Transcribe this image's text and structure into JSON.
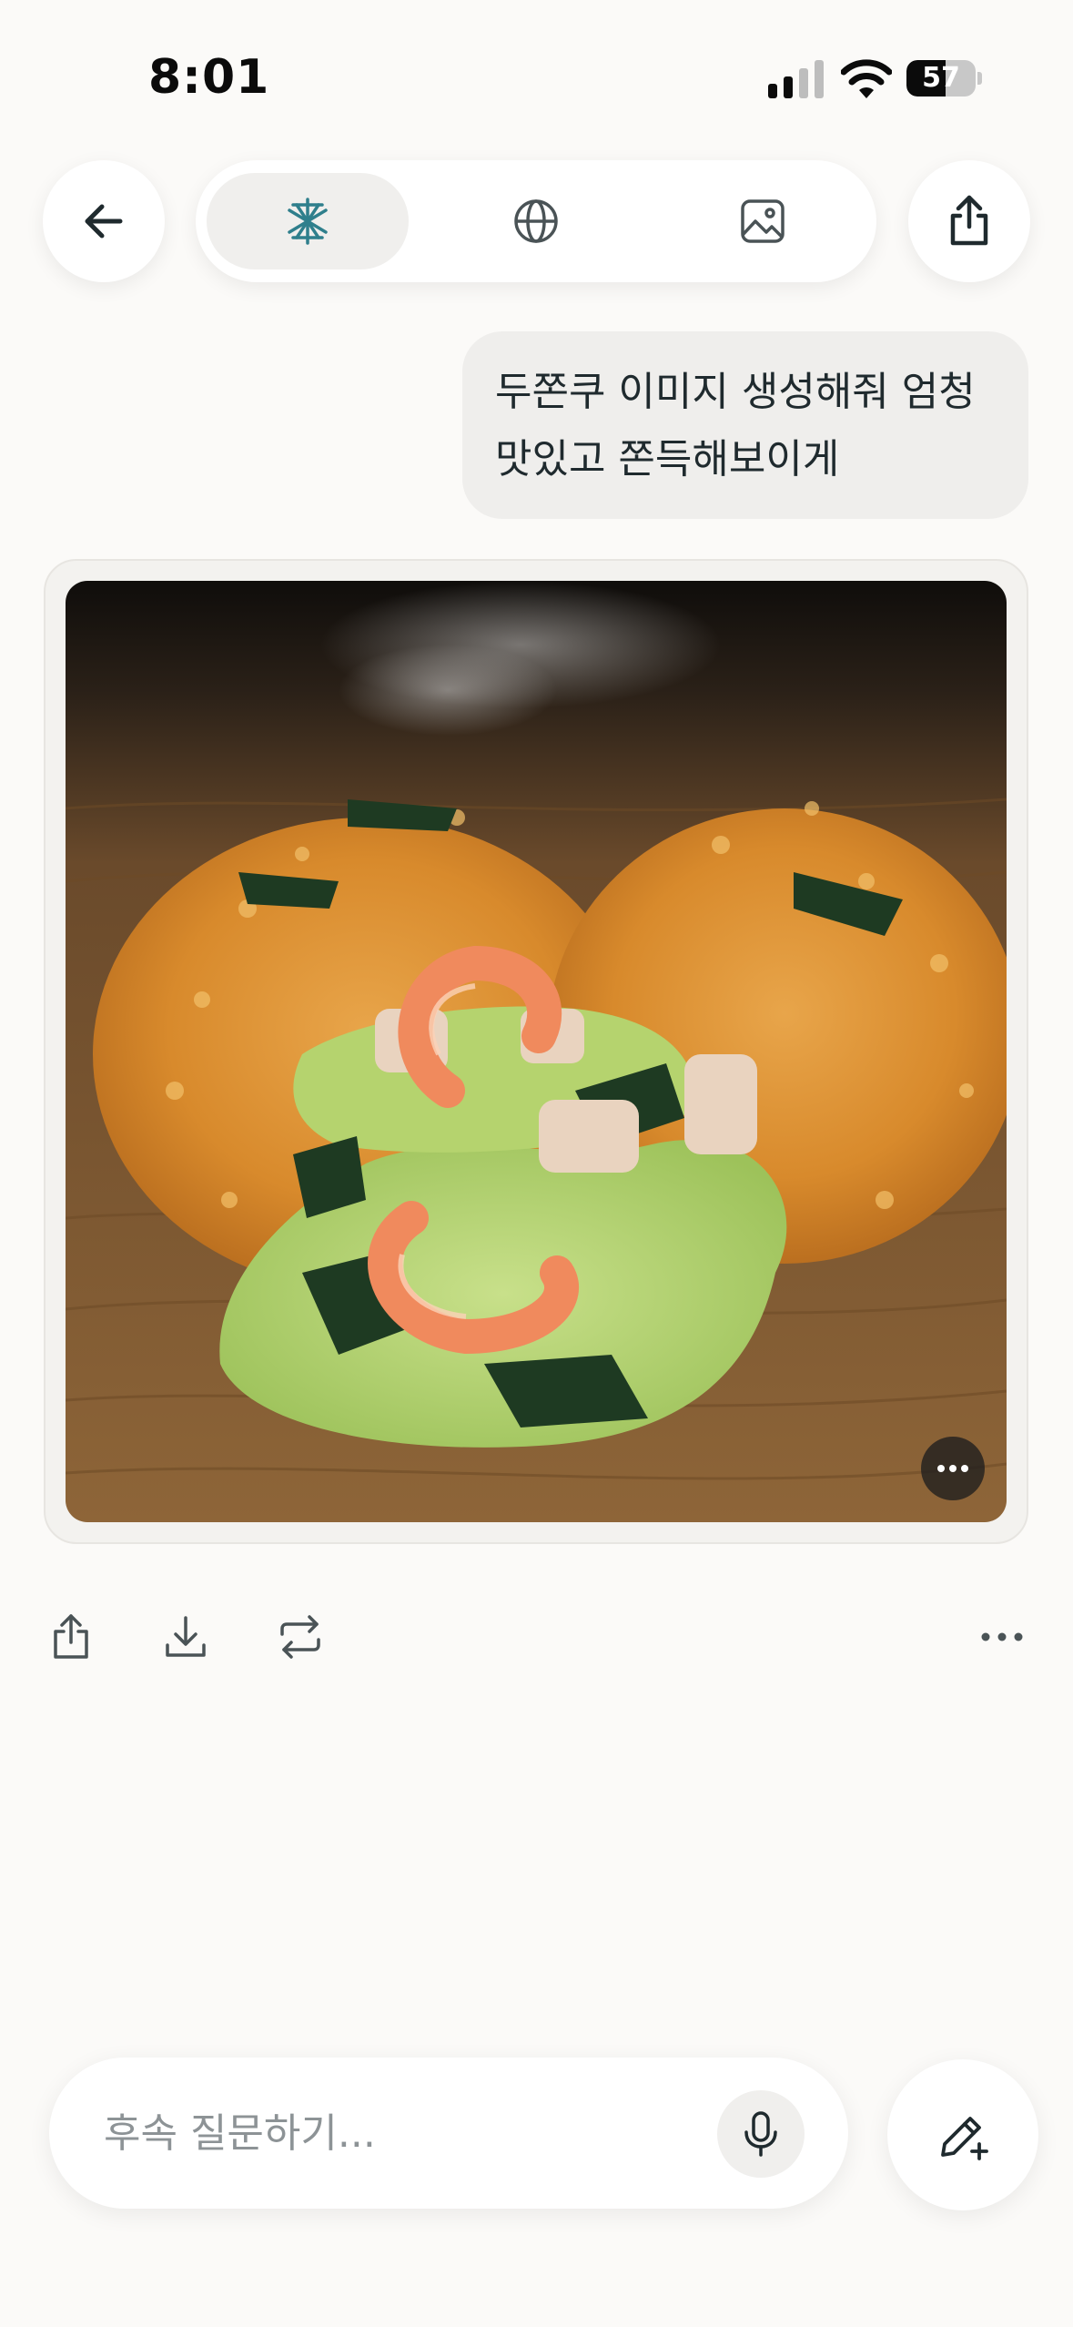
{
  "status_bar": {
    "time": "8:01",
    "battery": "57",
    "battery_level": 0.57
  },
  "top_bar": {
    "back_icon": "arrow-left-icon",
    "tabs": [
      {
        "icon": "research-spark-icon",
        "active": true
      },
      {
        "icon": "globe-icon",
        "active": false
      },
      {
        "icon": "image-icon",
        "active": false
      }
    ],
    "share_icon": "share-icon"
  },
  "chat": {
    "user_message_lines": [
      "두쫀쿠 이미지 생성해줘 엄청",
      "맛있고 쫀득해보이게"
    ],
    "generated_image": {
      "subject": "croquette",
      "more_icon": "ellipsis-icon"
    }
  },
  "actions": {
    "icons": [
      "share-icon",
      "download-icon",
      "regenerate-icon",
      "more-icon"
    ]
  },
  "composer": {
    "placeholder": "후속 질문하기...",
    "mic_icon": "microphone-icon",
    "new_chat_icon": "compose-icon"
  },
  "colors": {
    "background": "#fbfaf8",
    "accent": "#2f7f8c",
    "icon": "#1f2a2e"
  }
}
